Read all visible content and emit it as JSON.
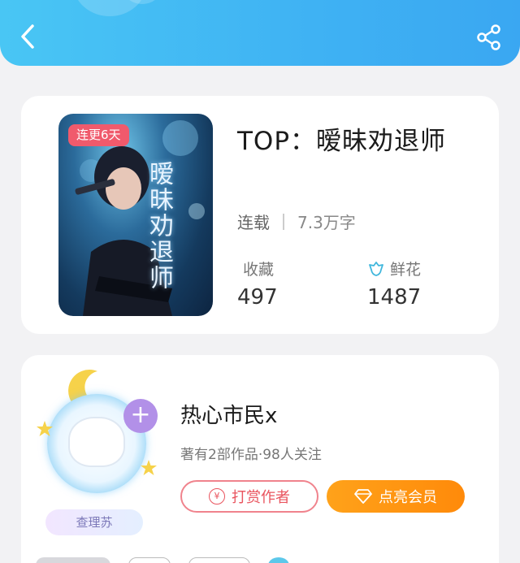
{
  "header": {
    "back_icon": "chevron-left-icon",
    "share_icon": "share-icon",
    "background_color": "#3fb2f3"
  },
  "book": {
    "title": "TOP：暧昧劝退师",
    "cover_badge": "连更6天",
    "cover_calligraphy": "暧昧劝退师",
    "status": "连载",
    "word_count": "7.3万字",
    "stats": {
      "collect_label": "收藏",
      "collect_value": "497",
      "flower_label": "鲜花",
      "flower_value": "1487",
      "flower_icon": "flower-icon"
    }
  },
  "author": {
    "name": "热心市民x",
    "stats_text": "著有2部作品·98人关注",
    "nickname_badge": "查理苏",
    "follow_icon": "plus-icon",
    "tip_button": "打赏作者",
    "tip_icon": "yen-coin-icon",
    "vip_button": "点亮会员",
    "vip_icon": "diamond-icon",
    "accent_color": "#ff8a0a",
    "tip_color": "#e9545e"
  }
}
